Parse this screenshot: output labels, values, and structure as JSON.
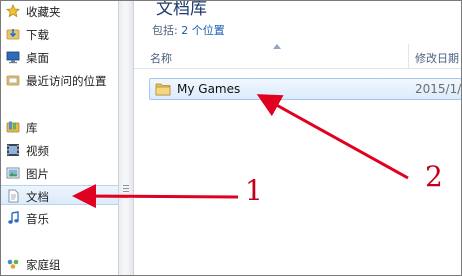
{
  "navigation": {
    "items": [
      {
        "label": "收藏夹",
        "icon": "star-icon"
      },
      {
        "label": "下载",
        "icon": "download-folder-icon"
      },
      {
        "label": "桌面",
        "icon": "desktop-icon"
      },
      {
        "label": "最近访问的位置",
        "icon": "recent-places-icon"
      },
      {
        "label": "库",
        "icon": "libraries-icon"
      },
      {
        "label": "视频",
        "icon": "video-library-icon"
      },
      {
        "label": "图片",
        "icon": "pictures-library-icon"
      },
      {
        "label": "文档",
        "icon": "documents-library-icon"
      },
      {
        "label": "音乐",
        "icon": "music-library-icon"
      },
      {
        "label": "家庭组",
        "icon": "homegroup-icon"
      }
    ],
    "selected": "文档"
  },
  "library": {
    "title": "文档库",
    "includes_prefix": "包括:",
    "includes_link": "2 个位置"
  },
  "columns": {
    "name": "名称",
    "date_modified": "修改日期"
  },
  "files": [
    {
      "name": "My Games",
      "date": "2015/1/",
      "icon": "folder-icon"
    }
  ],
  "annotations": {
    "label_1": "1",
    "label_2": "2",
    "color": "#c3001b"
  }
}
